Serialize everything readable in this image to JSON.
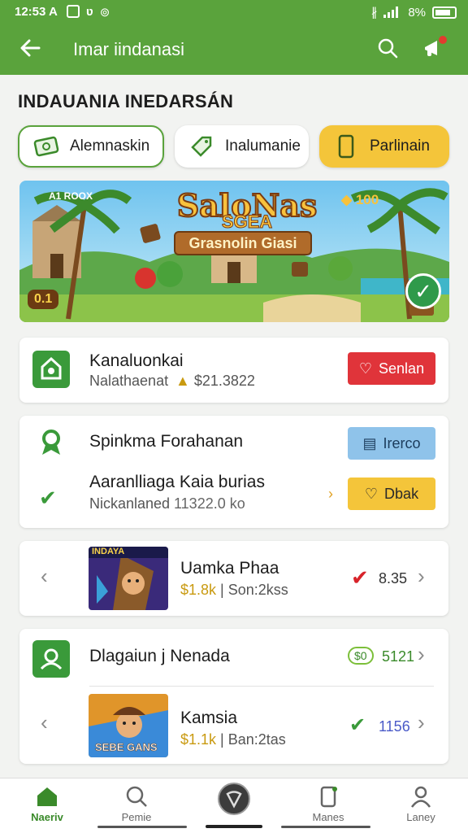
{
  "status_bar": {
    "time": "12:53 A",
    "battery_text": "8%"
  },
  "app_bar": {
    "title": "Imar iindanasi",
    "back_icon": "arrow-left-icon",
    "search_icon": "search-icon",
    "notification_icon": "megaphone-icon"
  },
  "section_title": "INDAUANIA INEDARSÁN",
  "chips": [
    {
      "label": "Alemnaskin",
      "icon": "money-icon"
    },
    {
      "label": "Inalumanie",
      "icon": "tag-icon"
    },
    {
      "label": "Parlinain",
      "icon": "phone-icon"
    }
  ],
  "banner": {
    "title": "SaloNas",
    "subtitle": "SGEA",
    "plank_text": "Grasnolin Giasi",
    "coins": "100",
    "small_text": "A1 ROOX",
    "badge": "0.1"
  },
  "card1": {
    "title": "Kanaluonkai",
    "subtitle": "Nalathaenat",
    "amount": "$21.3822",
    "button": "Senlan"
  },
  "card2": {
    "row1_title": "Spinkma Forahanan",
    "row1_button": "Irerco",
    "row2_title": "Aaranlliaga Kaia burias",
    "row2_subtitle": "Nickanlaned",
    "row2_amount": "11322.0 ko",
    "row2_button": "Dbak"
  },
  "card3": {
    "title": "Uamka Phaa",
    "price": "$1.8k",
    "subtitle": "Son:2kss",
    "value": "8.35",
    "thumb_label": "INDAYA"
  },
  "card4": {
    "header_title": "Dlagaiun j Nenada",
    "header_value": "5121",
    "header_badge": "$0",
    "item_title": "Kamsia",
    "item_price": "$1.1k",
    "item_subtitle": "Ban:2tas",
    "item_value": "1156",
    "thumb_label": "SEBE GANS"
  },
  "bottom_nav": [
    {
      "label": "Naeriv",
      "icon": "home-icon",
      "active": true
    },
    {
      "label": "Pemie",
      "icon": "search-icon",
      "active": false
    },
    {
      "label": "",
      "icon": "center-action-icon",
      "active": false
    },
    {
      "label": "Manes",
      "icon": "phone-icon",
      "active": false
    },
    {
      "label": "Laney",
      "icon": "person-icon",
      "active": false
    }
  ],
  "colors": {
    "primary": "#5aa33c",
    "accent_yellow": "#f4c53a",
    "danger": "#e0343a",
    "info_blue": "#8fc3ea"
  }
}
